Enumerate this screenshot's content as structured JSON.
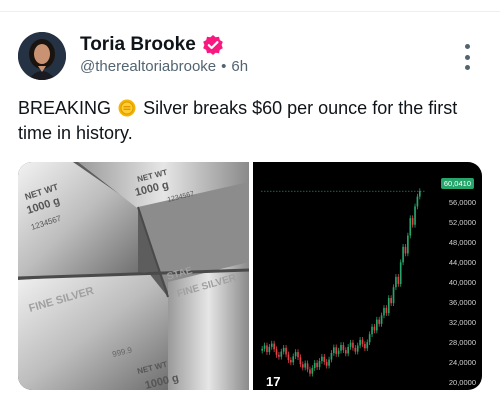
{
  "post": {
    "display_name": "Toria Brooke",
    "handle": "@therealtoriabrooke",
    "separator": "•",
    "timestamp": "6h",
    "text_before": "BREAKING",
    "text_after": "Silver breaks $60 per ounce for the first time in history."
  },
  "silver_bar_labels": [
    "NET WT",
    "1000 g",
    "1234567",
    "FINE SILVER",
    "999.9",
    "STAE",
    "NET WT",
    "1000 g"
  ],
  "chart": {
    "last_price": "60,0410",
    "ticks": [
      "56,0000",
      "52,0000",
      "48,0000",
      "44,0000",
      "40,0000",
      "36,0000",
      "32,0000",
      "28,0000",
      "24,0000",
      "20,0000"
    ],
    "logo": "17"
  },
  "chart_data": {
    "type": "candlestick",
    "ylim": [
      19,
      62
    ],
    "y_ticks": [
      56,
      52,
      48,
      44,
      40,
      36,
      32,
      28,
      24,
      20
    ],
    "closes": [
      26.5,
      27.2,
      25.8,
      26.9,
      27.6,
      26.4,
      25.2,
      24.8,
      25.9,
      26.7,
      25.3,
      24.1,
      23.6,
      24.9,
      25.8,
      24.7,
      23.2,
      22.5,
      23.4,
      22.1,
      21.2,
      22.4,
      23.5,
      22.6,
      23.9,
      24.8,
      23.7,
      22.9,
      24.2,
      25.6,
      26.8,
      25.4,
      26.1,
      27.3,
      26.2,
      25.5,
      26.9,
      27.8,
      26.7,
      25.9,
      27.2,
      28.4,
      27.5,
      26.6,
      27.9,
      29.6,
      31.2,
      30.4,
      32.7,
      31.8,
      33.6,
      35.2,
      34.1,
      37.3,
      36.2,
      39.6,
      41.8,
      40.3,
      44.9,
      48.2,
      46.8,
      50.6,
      54.3,
      52.9,
      56.8,
      58.9,
      60.04
    ],
    "colors": {
      "up": "#26a66b",
      "down": "#e0424a"
    }
  },
  "colors": {
    "verified_badge": "#f91880",
    "handle": "#536471",
    "text": "#0f1419"
  }
}
